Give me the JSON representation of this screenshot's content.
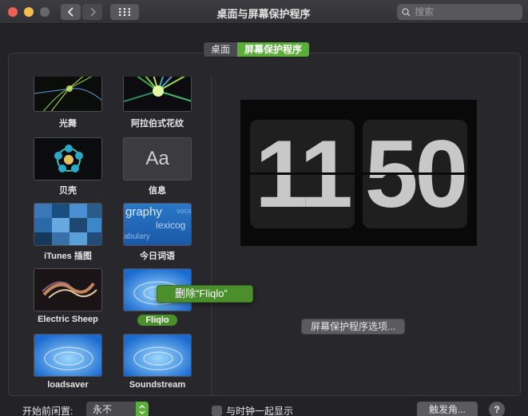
{
  "window": {
    "title": "桌面与屏幕保护程序",
    "search_placeholder": "搜索"
  },
  "tabs": [
    {
      "label": "桌面",
      "active": false
    },
    {
      "label": "屏幕保护程序",
      "active": true
    }
  ],
  "savers": [
    {
      "label": "光舞"
    },
    {
      "label": "阿拉伯式花纹"
    },
    {
      "label": "贝壳"
    },
    {
      "label": "信息",
      "thumb_text": "Aa"
    },
    {
      "label": "iTunes 插图"
    },
    {
      "label": "今日词语",
      "thumb_words": [
        "graphy",
        "lexicog",
        "abulary",
        "voca"
      ]
    },
    {
      "label": "Electric Sheep"
    },
    {
      "label": "Fliqlo",
      "selected": true
    },
    {
      "label": "loadsaver"
    },
    {
      "label": "Soundstream"
    }
  ],
  "context_menu": {
    "label": "删除“Fliqlo”"
  },
  "preview": {
    "hours": "11",
    "minutes": "50"
  },
  "options_button": "屏幕保护程序选项...",
  "bottom": {
    "start_after_label": "开始前闲置:",
    "start_after_value": "永不",
    "show_clock_label": "与时钟一起显示",
    "show_clock_checked": false,
    "hot_corners_button": "触发角...",
    "help_button": "?"
  },
  "colors": {
    "accent": "#5cae3a",
    "selection": "#4a8f2c",
    "background": "#232227"
  },
  "icons": [
    "back-icon",
    "forward-icon",
    "grid-icon",
    "search-icon",
    "chevron-updown-icon"
  ]
}
